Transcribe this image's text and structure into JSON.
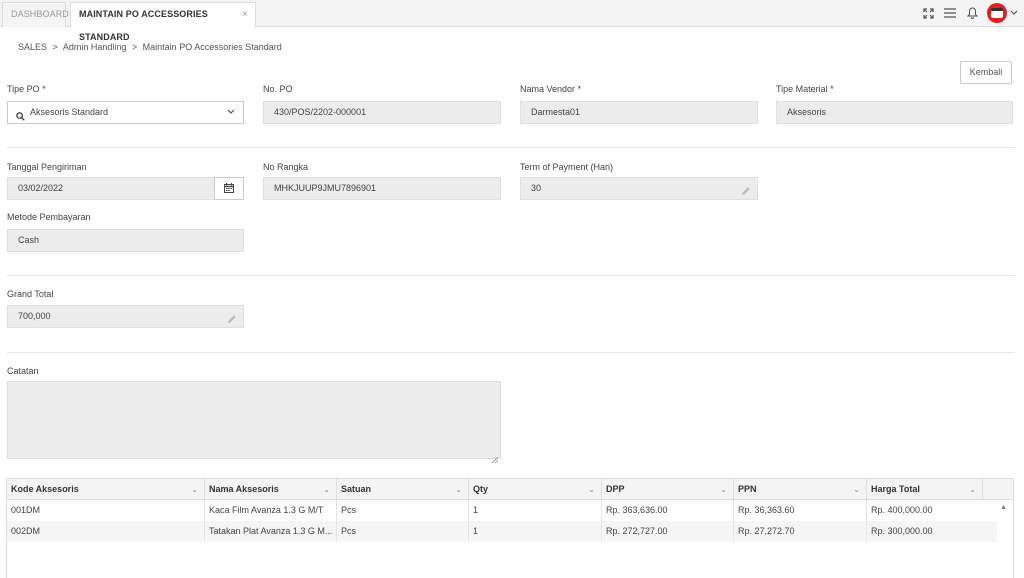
{
  "tabs": [
    {
      "label": "DASHBOARD"
    },
    {
      "label": "MAINTAIN PO ACCESSORIES STANDARD",
      "close": "×"
    }
  ],
  "topbar_icons": [
    "expand-icon",
    "menu-icon",
    "bell-icon",
    "avatar",
    "chevron-down-icon"
  ],
  "breadcrumb": {
    "items": [
      "SALES",
      "Admin Handling",
      "Maintain PO Accessories Standard"
    ],
    "separator": ">"
  },
  "buttons": {
    "kembali": "Kembali"
  },
  "form": {
    "tipe_po": {
      "label": "Tipe PO *",
      "value": "Aksesoris Standard"
    },
    "no_po": {
      "label": "No. PO",
      "value": "430/POS/2202-000001"
    },
    "nama_vendor": {
      "label": "Nama Vendor *",
      "value": "Darmesta01"
    },
    "tipe_material": {
      "label": "Tipe Material *",
      "value": "Aksesoris"
    },
    "tanggal_pengiriman": {
      "label": "Tanggal Pengiriman",
      "value": "03/02/2022"
    },
    "no_rangka": {
      "label": "No Rangka",
      "value": "MHKJUUP9JMU7896901"
    },
    "term_of_payment": {
      "label": "Term of Payment (Hari)",
      "value": "30"
    },
    "metode_pembayaran": {
      "label": "Metode Pembayaran",
      "value": "Cash"
    },
    "grand_total": {
      "label": "Grand Total",
      "value": "700,000"
    },
    "catatan": {
      "label": "Catatan",
      "value": ""
    }
  },
  "table": {
    "columns": [
      "Kode Aksesoris",
      "Nama Aksesoris",
      "Satuan",
      "Qty",
      "DPP",
      "PPN",
      "Harga Total"
    ],
    "rows": [
      [
        "001DM",
        "Kaca Film Avanza 1.3 G M/T",
        "Pcs",
        "1",
        "Rp. 363,636.00",
        "Rp. 36,363.60",
        "Rp. 400,000.00"
      ],
      [
        "002DM",
        "Tatakan Plat Avanza 1.3 G M...",
        "Pcs",
        "1",
        "Rp. 272,727.00",
        "Rp. 27,272.70",
        "Rp. 300,000.00"
      ]
    ]
  },
  "colors": {
    "accent": "#e02020",
    "field_bg": "#ececec",
    "row_alt": "#f5f5f5"
  }
}
